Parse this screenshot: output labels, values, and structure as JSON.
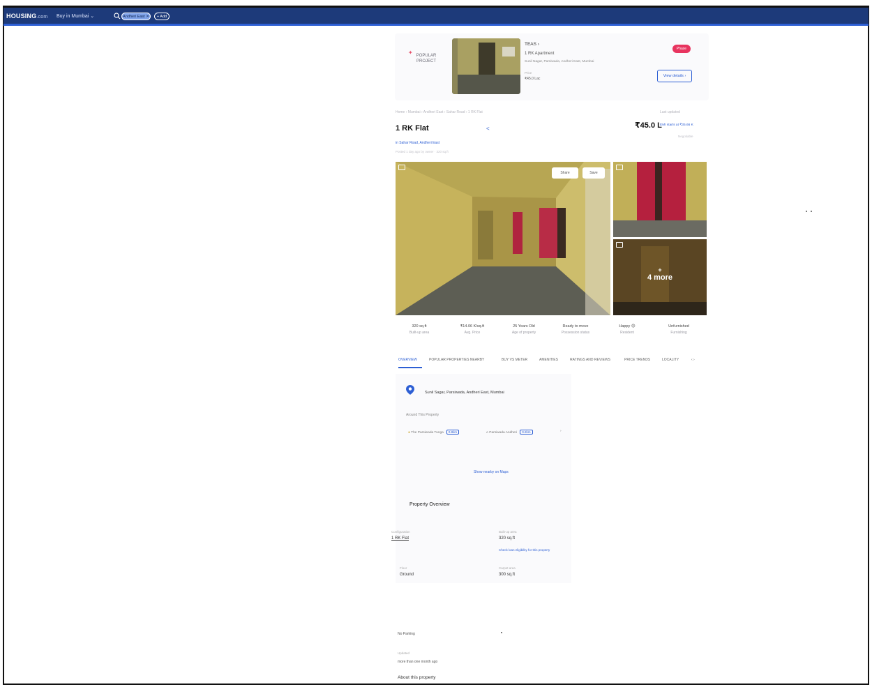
{
  "brand": {
    "name": "HOUSING",
    "suffix": ".com"
  },
  "nav": {
    "menu_label": "Buy in Mumbai ⌄",
    "location_chip": "Andheri East ✕",
    "add_chip": "+ Add"
  },
  "promo": {
    "badge_line1": "POPULAR",
    "badge_line2": "PROJECT",
    "project_name": "TEAS ›",
    "project_type": "1 RK Apartment",
    "project_address": "Sunil Nagar, Parsiwada, Andheri East, Mumbai",
    "price_label": "Price",
    "price_value": "₹45.0 Lac",
    "pill": "Phase",
    "view_button": "View details ›"
  },
  "breadcrumb": "Home › Mumbai › Andheri East › Sahar Road › 1 RK Flat",
  "breadcrumb_right": "Last updated",
  "listing": {
    "title": "1 RK Flat",
    "share_glyph": "<",
    "price": "₹45.0 L",
    "emi": "EMI starts at ₹35.66 K",
    "price_note": "Negotiable",
    "location_link": "in Sahar Road, Andheri East",
    "meta": "Posted 1 day ago by owner · 320 sq.ft"
  },
  "gallery": {
    "share_label": "Share",
    "save_label": "Save",
    "more_plus": "+",
    "more_label": "4 more"
  },
  "stats": [
    {
      "value": "320 sq.ft",
      "label": "Built-up area"
    },
    {
      "value": "₹14.06 K/sq.ft",
      "label": "Avg. Price"
    },
    {
      "value": "25 Years Old",
      "label": "Age of property"
    },
    {
      "value": "Ready to move",
      "label": "Possession status"
    },
    {
      "value": "Happy 😊",
      "label": "Resident"
    },
    {
      "value": "Unfurnished",
      "label": "Furnishing"
    }
  ],
  "tabs": [
    "OVERVIEW",
    "POPULAR PROPERTIES NEARBY",
    "BUY VS METER",
    "AMENITIES",
    "RATINGS AND REVIEWS",
    "PRICE TRENDS",
    "LOCALITY",
    "‹ ›"
  ],
  "overview": {
    "address": "Sunil Sagar, Parsiwada, Andheri East, Mumbai",
    "near_label": "Around This Property",
    "nearby": [
      {
        "name": "The Parsiwada Tunga",
        "tag": "0.8km"
      },
      {
        "name": "Parsiwada Andheri",
        "tag": "0.2km"
      }
    ],
    "view_map": "Show nearby on Maps",
    "section_title": "Property Overview",
    "items": [
      {
        "label": "Configuration",
        "value": "1 RK Flat"
      },
      {
        "label": "Built-up area",
        "value": "320 sq.ft"
      },
      {
        "label": "Floor",
        "value": "Ground"
      },
      {
        "label": "Carpet area",
        "value": "300 sq.ft"
      }
    ],
    "link": "Check loan eligibility for this property"
  },
  "details": {
    "parking": "No Parking",
    "posted_label": "Updated",
    "posted_value": "more than one month ago",
    "about": "About this property"
  },
  "colors": {
    "nav": "#1d3a7a",
    "accent": "#2d5fd4",
    "pill": "#e8345f"
  }
}
